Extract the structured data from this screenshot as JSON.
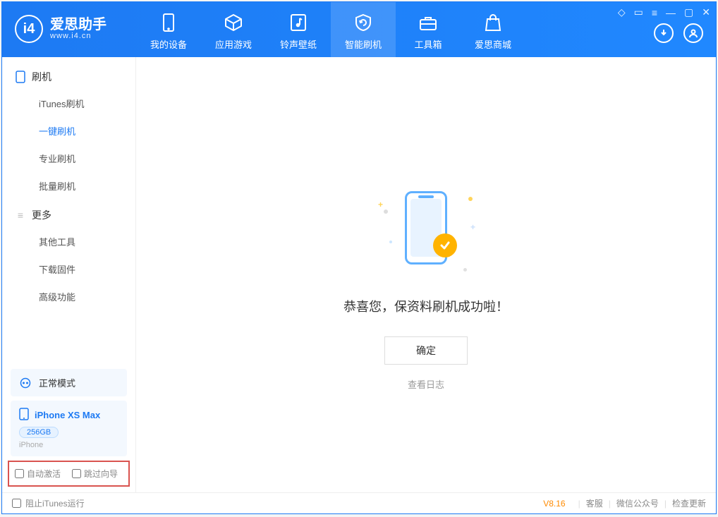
{
  "app": {
    "name_cn": "爱思助手",
    "domain": "www.i4.cn"
  },
  "topnav": {
    "tabs": [
      {
        "label": "我的设备"
      },
      {
        "label": "应用游戏"
      },
      {
        "label": "铃声壁纸"
      },
      {
        "label": "智能刷机"
      },
      {
        "label": "工具箱"
      },
      {
        "label": "爱思商城"
      }
    ],
    "active_index": 3
  },
  "sidebar": {
    "sections": [
      {
        "title": "刷机",
        "items": [
          {
            "label": "iTunes刷机"
          },
          {
            "label": "一键刷机"
          },
          {
            "label": "专业刷机"
          },
          {
            "label": "批量刷机"
          }
        ],
        "active_index": 1
      },
      {
        "title": "更多",
        "items": [
          {
            "label": "其他工具"
          },
          {
            "label": "下载固件"
          },
          {
            "label": "高级功能"
          }
        ]
      }
    ]
  },
  "sidefoot": {
    "mode_label": "正常模式",
    "device_name": "iPhone XS Max",
    "device_capacity": "256GB",
    "device_type": "iPhone",
    "opt_auto_activate": "自动激活",
    "opt_skip_guide": "跳过向导"
  },
  "content": {
    "headline": "恭喜您，保资料刷机成功啦！",
    "ok_button": "确定",
    "view_log": "查看日志"
  },
  "statusbar": {
    "left_checkbox": "阻止iTunes运行",
    "version": "V8.16",
    "link_support": "客服",
    "link_wechat": "微信公众号",
    "link_update": "检查更新"
  }
}
